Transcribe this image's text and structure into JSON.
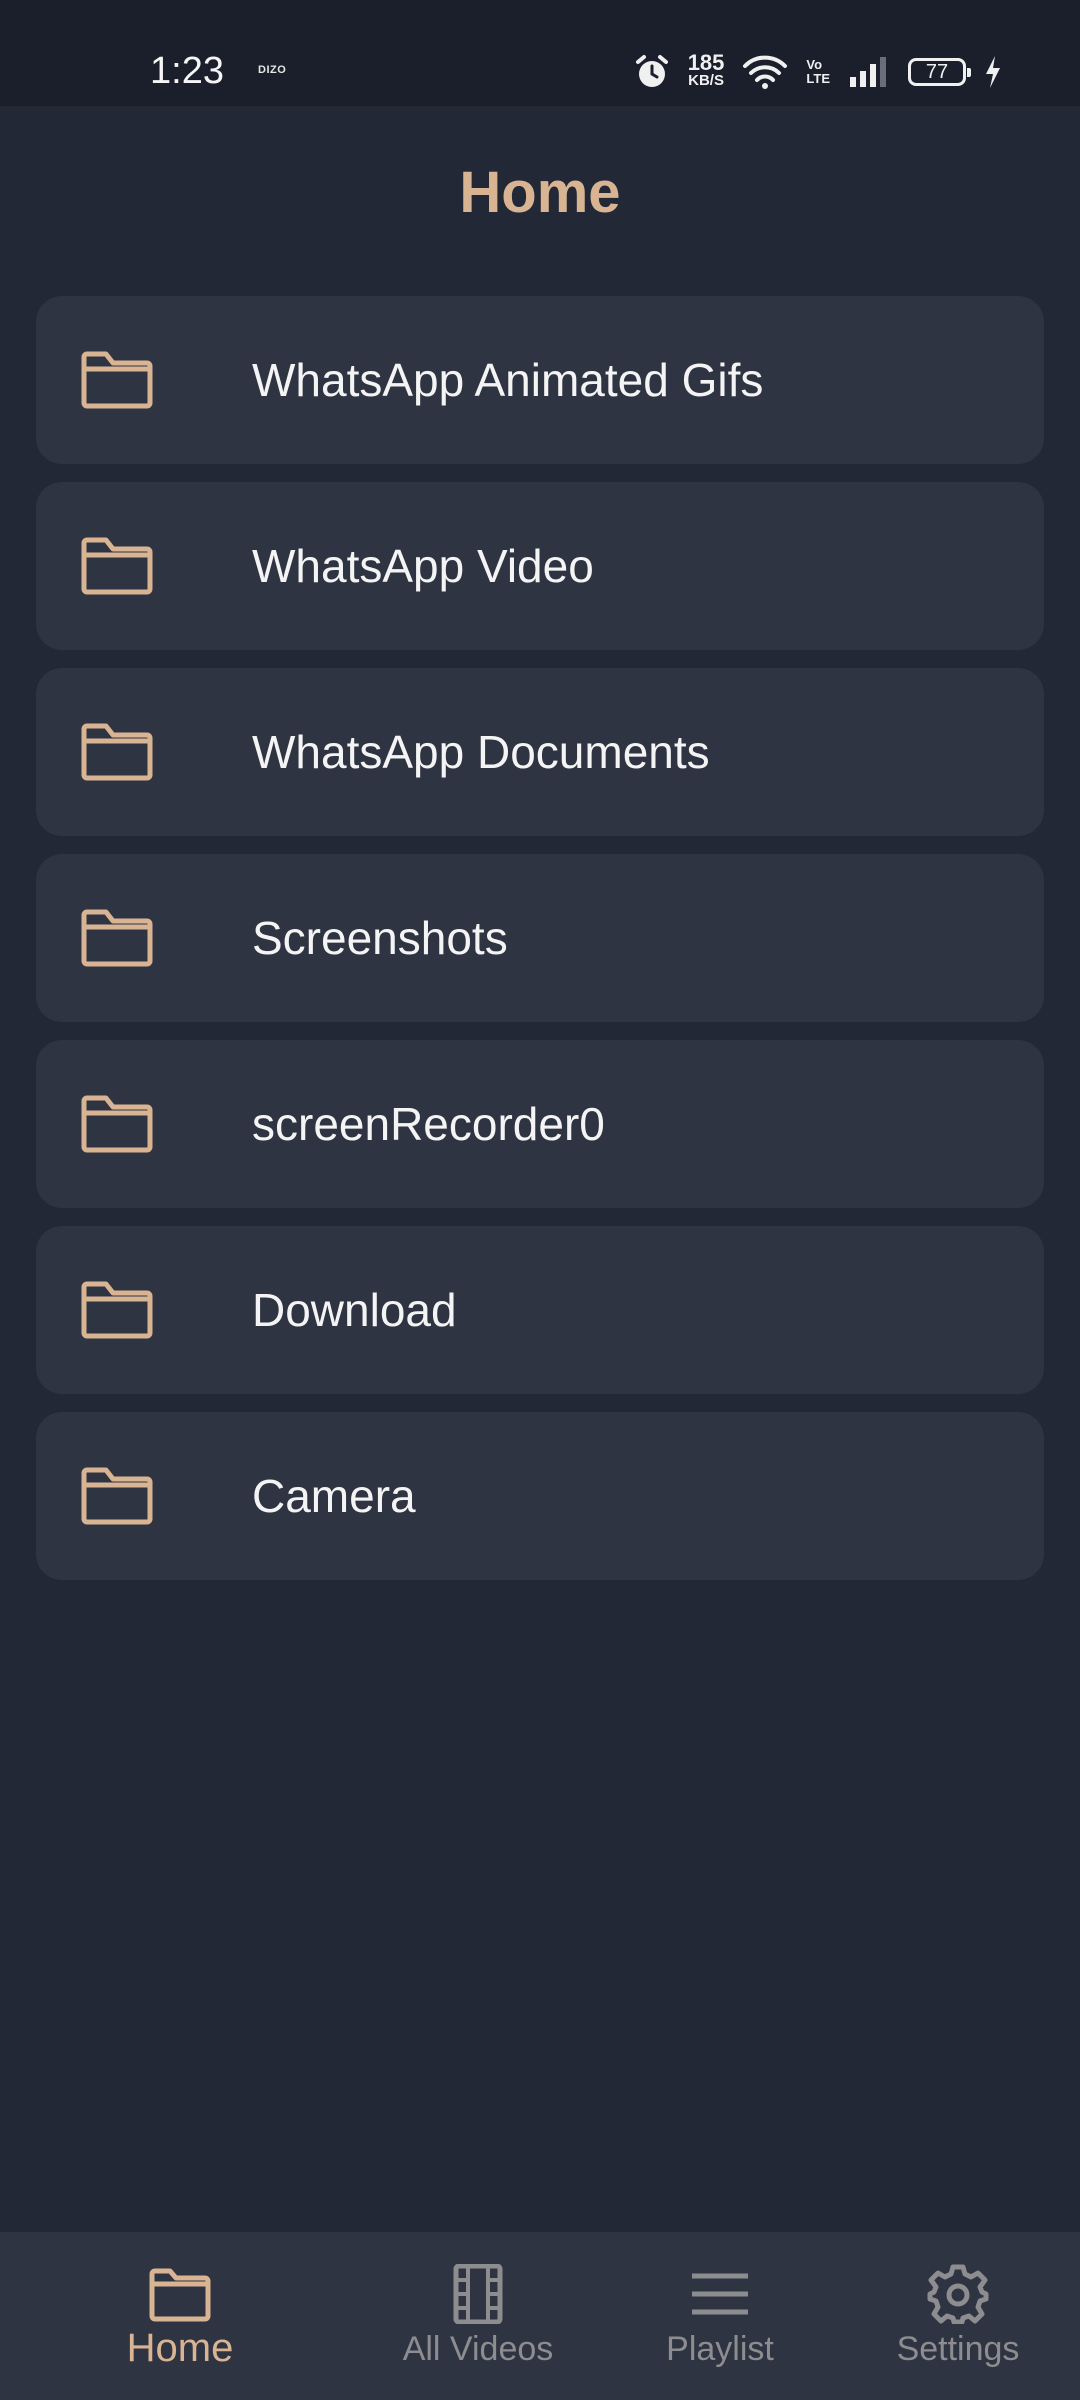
{
  "status_bar": {
    "time": "1:23",
    "carrier": "DIZO",
    "speed_value": "185",
    "speed_unit": "KB/S",
    "volte_top": "Vo",
    "volte_bottom": "LTE",
    "battery": "77"
  },
  "header": {
    "title": "Home"
  },
  "folders": [
    {
      "label": "WhatsApp Animated Gifs"
    },
    {
      "label": "WhatsApp Video"
    },
    {
      "label": "WhatsApp Documents"
    },
    {
      "label": "Screenshots"
    },
    {
      "label": "screenRecorder0"
    },
    {
      "label": "Download"
    },
    {
      "label": "Camera"
    }
  ],
  "bottom_nav": {
    "items": [
      {
        "label": "Home",
        "icon": "folder-icon",
        "active": true
      },
      {
        "label": "All Videos",
        "icon": "film-icon",
        "active": false
      },
      {
        "label": "Playlist",
        "icon": "list-icon",
        "active": false
      },
      {
        "label": "Settings",
        "icon": "gear-icon",
        "active": false
      }
    ]
  },
  "colors": {
    "accent": "#d8b493",
    "background": "#222836",
    "card": "#2f3443",
    "inactive": "#8d8d90"
  }
}
